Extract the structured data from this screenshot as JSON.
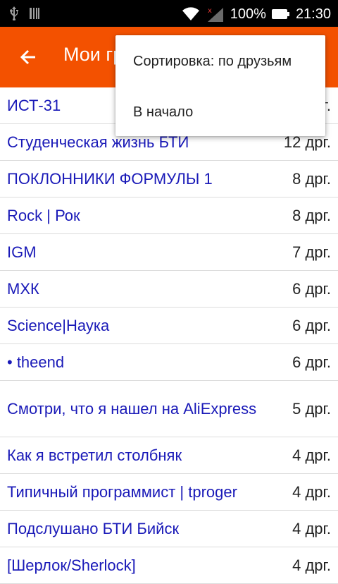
{
  "status": {
    "battery": "100%",
    "time": "21:30"
  },
  "appbar": {
    "title": "Мои группы",
    "accent": "#f35100"
  },
  "menu": {
    "items": [
      "Сортировка: по друзьям",
      "В начало"
    ]
  },
  "groups": [
    {
      "name": "ИСТ-31",
      "count": "drg"
    },
    {
      "name": "Студенческая жизнь БТИ",
      "count": "12 дрг."
    },
    {
      "name": "ПОКЛОННИКИ ФОРМУЛЫ 1",
      "count": "8 дрг."
    },
    {
      "name": "Rock | Рок",
      "count": "8 дрг."
    },
    {
      "name": "IGM",
      "count": "7 дрг."
    },
    {
      "name": "МХК",
      "count": "6 дрг."
    },
    {
      "name": "Science|Наука",
      "count": "6 дрг."
    },
    {
      "name": "• theend",
      "count": "6 дрг."
    },
    {
      "name": "Смотри, что я нашел на AliExpress",
      "count": "5 дрг."
    },
    {
      "name": "Как я встретил столбняк",
      "count": "4 дрг."
    },
    {
      "name": "Типичный программист | tproger",
      "count": "4 дрг."
    },
    {
      "name": "Подслушано БТИ Бийск",
      "count": "4 дрг."
    },
    {
      "name": "[Шерлок/Sherlock]",
      "count": "4 дрг."
    }
  ]
}
